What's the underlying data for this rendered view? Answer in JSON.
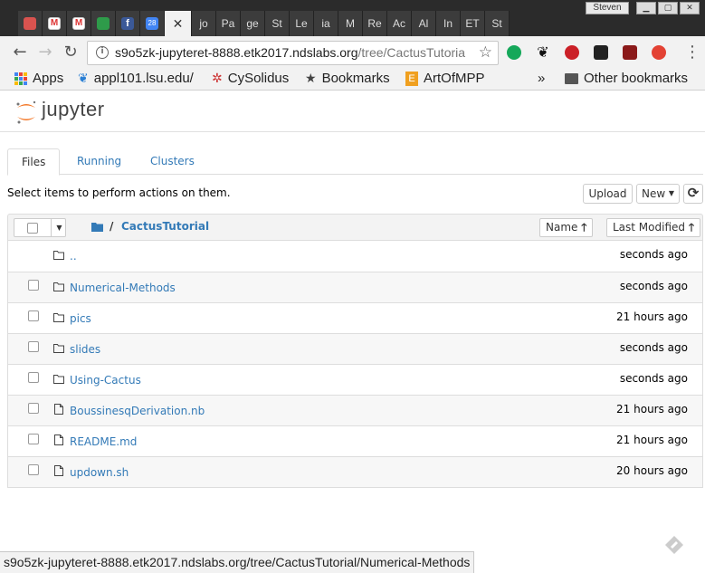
{
  "browser": {
    "profile_name": "Steven",
    "tabs": [
      {
        "label": "",
        "icon": "chrome-icon"
      },
      {
        "label": "",
        "icon": "gmail-icon"
      },
      {
        "label": "",
        "icon": "gmail-icon"
      },
      {
        "label": "",
        "icon": "green-arrows-icon"
      },
      {
        "label": "",
        "icon": "facebook-icon"
      },
      {
        "label": "28",
        "icon": "calendar-icon"
      },
      {
        "label": "",
        "icon": "close-icon",
        "active": true
      },
      {
        "label": "jo"
      },
      {
        "label": "Pa"
      },
      {
        "label": "ge"
      },
      {
        "label": "St"
      },
      {
        "label": "Le"
      },
      {
        "label": "ia"
      },
      {
        "label": "M"
      },
      {
        "label": "Re"
      },
      {
        "label": "Ac"
      },
      {
        "label": "Al"
      },
      {
        "label": "In"
      },
      {
        "label": "ET"
      },
      {
        "label": "St"
      }
    ],
    "url_host": "s9o5zk-jupyteret-8888.etk2017.ndslabs.org",
    "url_path": "/tree/CactusTutoria",
    "bookmarks": {
      "apps": "Apps",
      "items": [
        "appl101.lsu.edu/",
        "CySolidus",
        "Bookmarks",
        "ArtOfMPP"
      ],
      "overflow": "»",
      "other": "Other bookmarks"
    },
    "status_url": "s9o5zk-jupyteret-8888.etk2017.ndslabs.org/tree/CactusTutorial/Numerical-Methods"
  },
  "jupyter": {
    "logo_text": "jupyter",
    "tabs": [
      "Files",
      "Running",
      "Clusters"
    ],
    "hint": "Select items to perform actions on them.",
    "upload_label": "Upload",
    "new_label": "New",
    "breadcrumb_sep": "/",
    "breadcrumb_dir": "CactusTutorial",
    "sort_name": "Name",
    "sort_modified": "Last Modified",
    "files": [
      {
        "name": "..",
        "type": "folder",
        "modified": "seconds ago"
      },
      {
        "name": "Numerical-Methods",
        "type": "folder",
        "modified": "seconds ago"
      },
      {
        "name": "pics",
        "type": "folder",
        "modified": "21 hours ago"
      },
      {
        "name": "slides",
        "type": "folder",
        "modified": "seconds ago"
      },
      {
        "name": "Using-Cactus",
        "type": "folder",
        "modified": "seconds ago"
      },
      {
        "name": "BoussinesqDerivation.nb",
        "type": "file",
        "modified": "21 hours ago"
      },
      {
        "name": "README.md",
        "type": "file",
        "modified": "21 hours ago"
      },
      {
        "name": "updown.sh",
        "type": "file",
        "modified": "20 hours ago"
      }
    ]
  },
  "colors": {
    "link": "#337ab7",
    "chrome_dark": "#2b2b2b",
    "jupyter_orange": "#f37726"
  }
}
